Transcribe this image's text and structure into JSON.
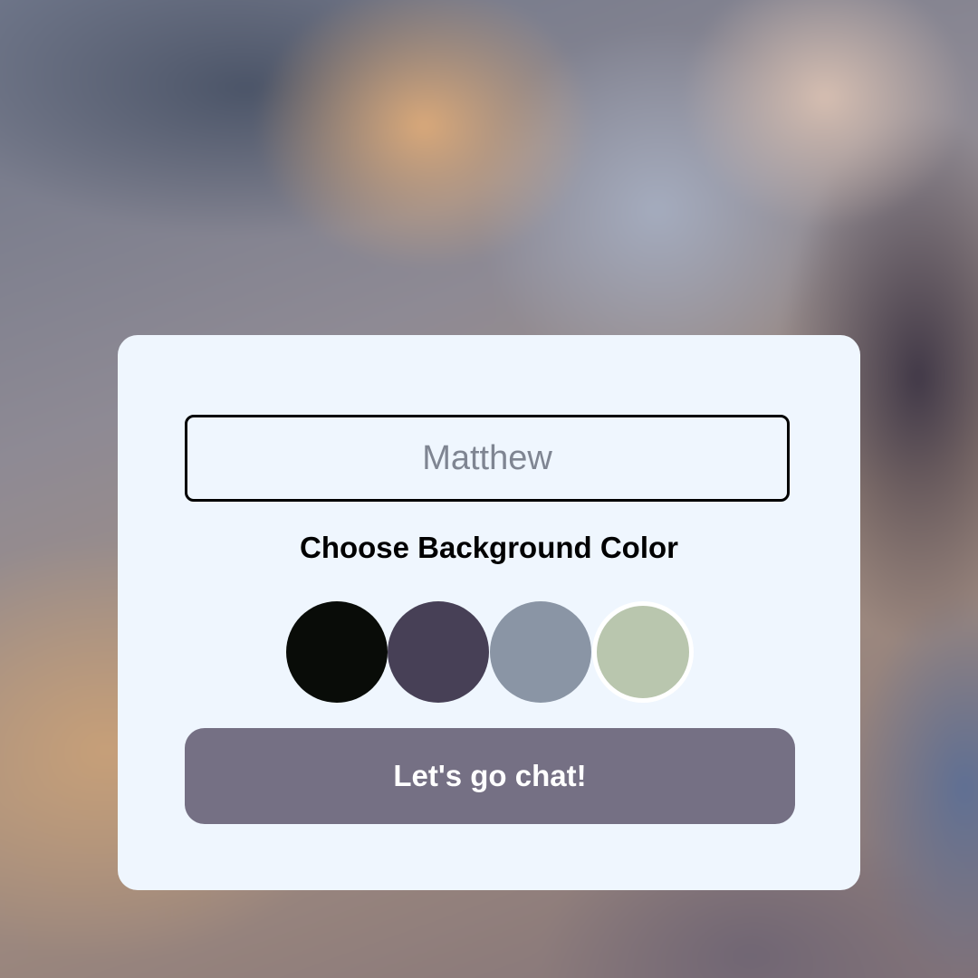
{
  "start_screen": {
    "name_input": {
      "placeholder": "Matthew",
      "value": ""
    },
    "color_heading": "Choose Background Color",
    "colors": [
      {
        "name": "black",
        "hex": "#090c08"
      },
      {
        "name": "purple",
        "hex": "#474056"
      },
      {
        "name": "grey",
        "hex": "#8a95a5"
      },
      {
        "name": "green",
        "hex": "#b9c6ae"
      }
    ],
    "selected_color": "green",
    "chat_button_label": "Let's go chat!"
  },
  "theme": {
    "card_background": "#eff6fe",
    "button_background": "#757084",
    "button_text": "#ffffff"
  }
}
